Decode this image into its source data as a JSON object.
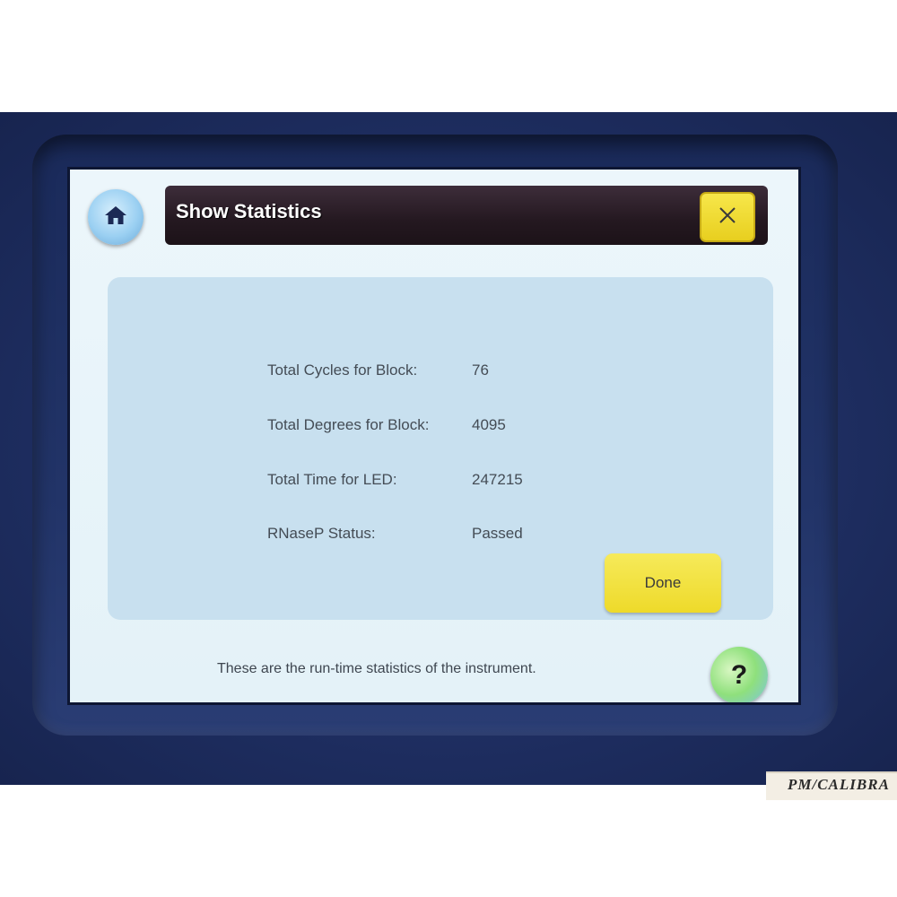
{
  "header": {
    "title": "Show Statistics",
    "home_icon": "home-icon",
    "close_icon": "close-icon",
    "accent_color": "#f2e23a"
  },
  "statistics": [
    {
      "label": "Total Cycles for Block:",
      "value": "76"
    },
    {
      "label": "Total Degrees for Block:",
      "value": "4095"
    },
    {
      "label": "Total Time for LED:",
      "value": "247215"
    },
    {
      "label": "RNaseP Status:",
      "value": "Passed"
    }
  ],
  "actions": {
    "done_label": "Done",
    "help_label": "?"
  },
  "footer": {
    "message": "These are the run-time statistics of the instrument."
  },
  "device": {
    "sticker_text": "PM/CALIBRA"
  }
}
